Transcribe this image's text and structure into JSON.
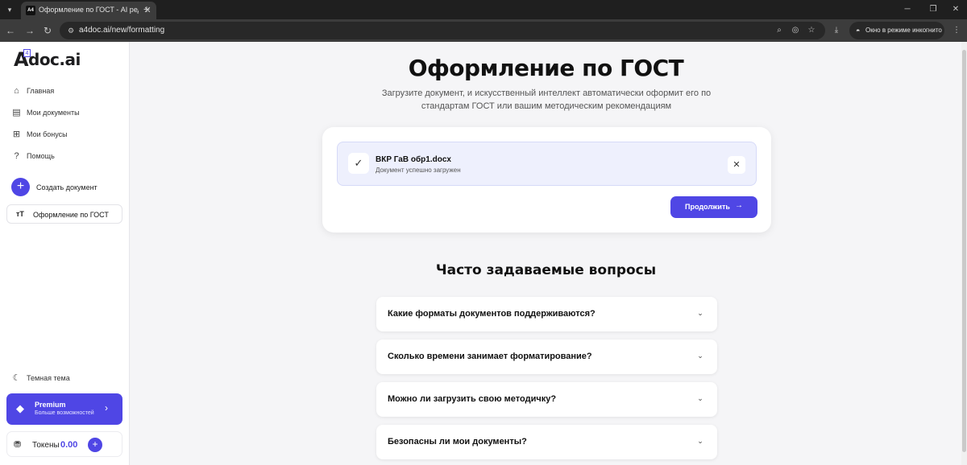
{
  "browser": {
    "tab_title": "Оформление по ГОСТ - AI ред",
    "favicon_text": "A4",
    "url": "a4doc.ai/new/formatting",
    "incognito_label": "Окно в режиме инкогнито"
  },
  "sidebar": {
    "logo_mark": "A",
    "logo_sup": "4",
    "logo_text": "doc.ai",
    "items": [
      {
        "label": "Главная",
        "icon": "home-icon"
      },
      {
        "label": "Мои документы",
        "icon": "document-icon"
      },
      {
        "label": "Мои бонусы",
        "icon": "gift-icon"
      },
      {
        "label": "Помощь",
        "icon": "help-icon"
      }
    ],
    "create_label": "Создать документ",
    "gost_icon_text": "тT",
    "gost_label": "Оформление по ГОСТ",
    "theme_label": "Темная тема",
    "premium": {
      "title": "Premium",
      "subtitle": "Больше возможностей"
    },
    "tokens": {
      "label": "Токены",
      "value": "0.00"
    }
  },
  "main": {
    "title": "Оформление по ГОСТ",
    "subtitle": "Загрузите документ, и искусственный интеллект автоматически оформит его по стандартам ГОСТ или вашим методическим рекомендациям",
    "upload": {
      "file_name": "ВКР ГаВ обр1.docx",
      "file_status": "Документ успешно загружен",
      "continue_label": "Продолжить"
    },
    "faq_title": "Часто задаваемые вопросы",
    "faq": [
      "Какие форматы документов поддерживаются?",
      "Сколько времени занимает форматирование?",
      "Можно ли загрузить свою методичку?",
      "Безопасны ли мои документы?"
    ]
  },
  "colors": {
    "accent": "#4f46e5",
    "file_row_bg": "#eef0fd"
  }
}
